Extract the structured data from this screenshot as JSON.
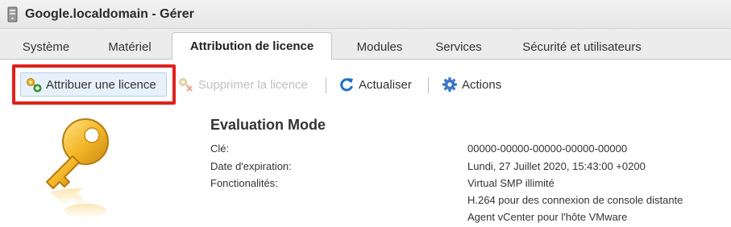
{
  "window": {
    "title": "Google.localdomain - Gérer",
    "icon": "host-icon"
  },
  "tabs": [
    {
      "label": "Système",
      "active": false
    },
    {
      "label": "Matériel",
      "active": false
    },
    {
      "label": "Attribution de licence",
      "active": true
    },
    {
      "label": "Modules",
      "active": false
    },
    {
      "label": "Services",
      "active": false
    },
    {
      "label": "Sécurité et utilisateurs",
      "active": false
    }
  ],
  "toolbar": {
    "assign_label": "Attribuer une licence",
    "remove_label": "Supprimer la licence",
    "refresh_label": "Actualiser",
    "actions_label": "Actions",
    "icons": [
      "assign-license-icon",
      "remove-license-icon",
      "refresh-icon",
      "gear-icon"
    ]
  },
  "license": {
    "mode": "Evaluation Mode",
    "key_label": "Clé:",
    "key_value": "00000-00000-00000-00000-00000",
    "expiration_label": "Date d'expiration:",
    "expiration_value": "Lundi, 27 Juillet 2020, 15:43:00 +0200",
    "features_label": "Fonctionalités:",
    "features": [
      "Virtual SMP illimité",
      "H.264 pour des connexion de console distante",
      "Agent vCenter pour l'hôte VMware"
    ]
  },
  "colors": {
    "highlight": "#e0211c",
    "selected_button_bg": "#e7f1fb",
    "key_gold": "#f0b323",
    "refresh_blue": "#1d6fc6",
    "gear_blue": "#3d78c5"
  }
}
